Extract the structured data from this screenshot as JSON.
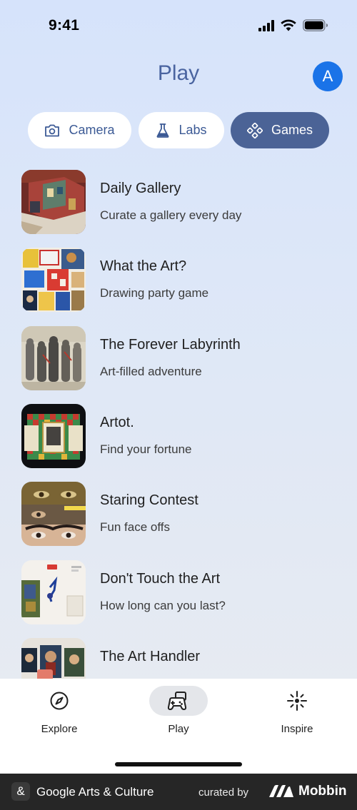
{
  "status_bar": {
    "time": "9:41"
  },
  "header": {
    "title": "Play",
    "avatar_letter": "A"
  },
  "chips": [
    {
      "label": "Camera",
      "icon": "camera-icon",
      "active": false
    },
    {
      "label": "Labs",
      "icon": "flask-icon",
      "active": false
    },
    {
      "label": "Games",
      "icon": "game-controller-icon",
      "active": true
    }
  ],
  "games": [
    {
      "title": "Daily Gallery",
      "subtitle": "Curate a gallery every day"
    },
    {
      "title": "What the Art?",
      "subtitle": "Drawing party game"
    },
    {
      "title": "The Forever Labyrinth",
      "subtitle": "Art-filled adventure"
    },
    {
      "title": "Artot.",
      "subtitle": "Find your fortune"
    },
    {
      "title": "Staring Contest",
      "subtitle": "Fun face offs"
    },
    {
      "title": "Don't Touch the Art",
      "subtitle": "How long can you last?"
    },
    {
      "title": "The Art Handler",
      "subtitle": ""
    }
  ],
  "bottom_nav": [
    {
      "label": "Explore",
      "icon": "compass-icon",
      "active": false
    },
    {
      "label": "Play",
      "icon": "gamepad-icon",
      "active": true
    },
    {
      "label": "Inspire",
      "icon": "sparkle-icon",
      "active": false
    }
  ],
  "footer": {
    "app_icon": "&",
    "app_name": "Google Arts & Culture",
    "curated_by": "curated by",
    "brand": "Mobbin"
  },
  "colors": {
    "accent": "#4b6396",
    "title": "#4a64a0",
    "avatar": "#1a73e8",
    "footer_bg": "#262626"
  }
}
